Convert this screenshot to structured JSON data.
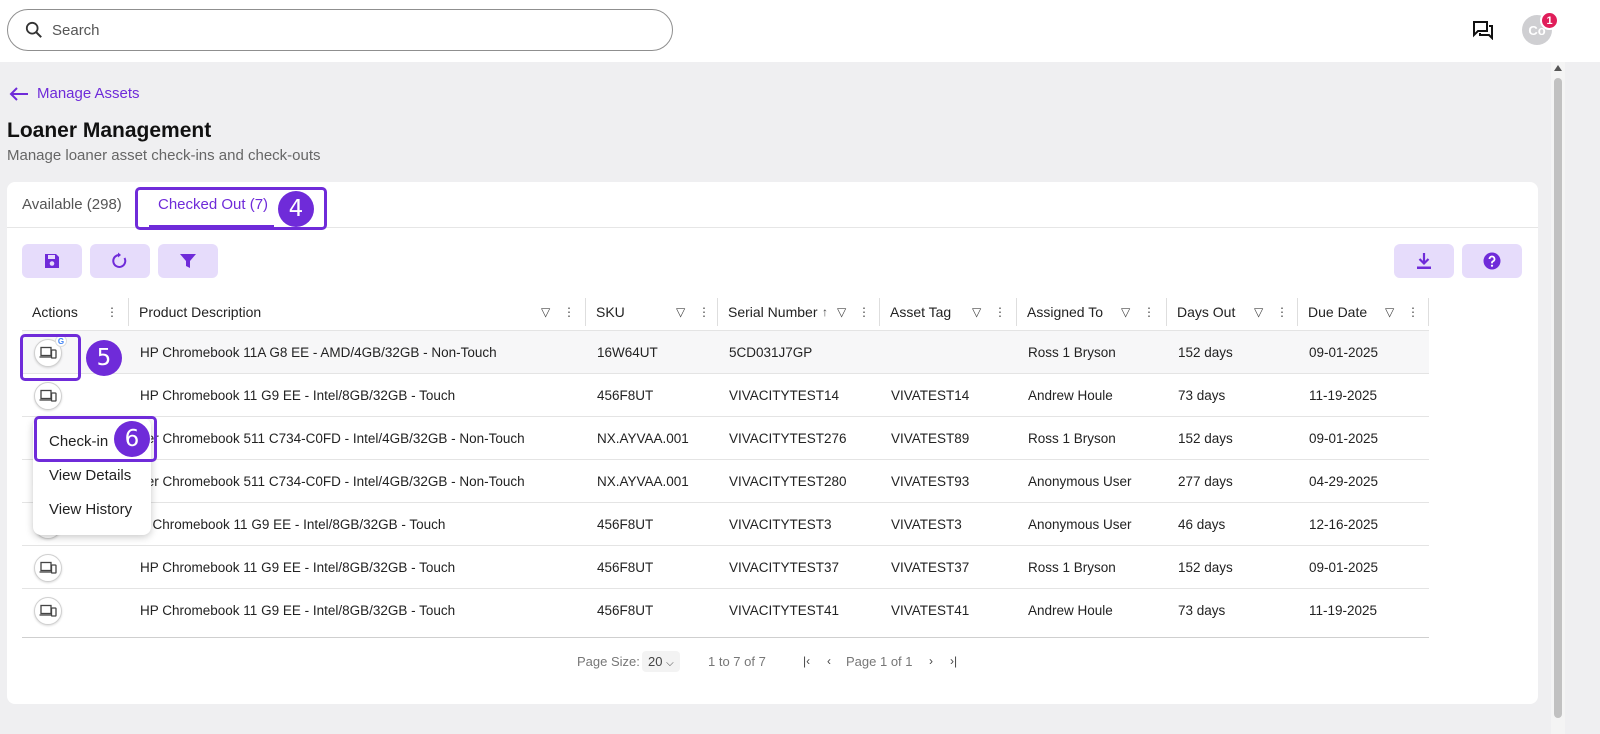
{
  "search": {
    "placeholder": "Search"
  },
  "header": {
    "avatar_initials": "Co",
    "notification_count": "1"
  },
  "breadcrumb": {
    "back_label": "Manage Assets"
  },
  "page": {
    "title": "Loaner Management",
    "subtitle": "Manage loaner asset check-ins and check-outs"
  },
  "tabs": [
    {
      "label": "Available (298)"
    },
    {
      "label": "Checked Out (7)"
    }
  ],
  "steps": {
    "tab": "4",
    "row_action": "5",
    "menu": "6"
  },
  "table": {
    "columns": [
      "Actions",
      "Product Description",
      "SKU",
      "Serial Number",
      "Asset Tag",
      "Assigned To",
      "Days Out",
      "Due Date"
    ],
    "sort_indicator": "↑",
    "rows": [
      {
        "product": "HP Chromebook 11A G8 EE - AMD/4GB/32GB - Non-Touch",
        "sku": "16W64UT",
        "serial": "5CD031J7GP",
        "asset_tag": "",
        "assigned_to": "Ross 1 Bryson",
        "days_out": "152 days",
        "due_date": "09-01-2025"
      },
      {
        "product": "HP Chromebook 11 G9 EE - Intel/8GB/32GB - Touch",
        "sku": "456F8UT",
        "serial": "VIVACITYTEST14",
        "asset_tag": "VIVATEST14",
        "assigned_to": "Andrew Houle",
        "days_out": "73 days",
        "due_date": "11-19-2025"
      },
      {
        "product": "cer Chromebook 511 C734-C0FD - Intel/4GB/32GB - Non-Touch",
        "sku": "NX.AYVAA.001",
        "serial": "VIVACITYTEST276",
        "asset_tag": "VIVATEST89",
        "assigned_to": "Ross 1 Bryson",
        "days_out": "152 days",
        "due_date": "09-01-2025"
      },
      {
        "product": "cer Chromebook 511 C734-C0FD - Intel/4GB/32GB - Non-Touch",
        "sku": "NX.AYVAA.001",
        "serial": "VIVACITYTEST280",
        "asset_tag": "VIVATEST93",
        "assigned_to": "Anonymous User",
        "days_out": "277 days",
        "due_date": "04-29-2025"
      },
      {
        "product": "P Chromebook 11 G9 EE - Intel/8GB/32GB - Touch",
        "sku": "456F8UT",
        "serial": "VIVACITYTEST3",
        "asset_tag": "VIVATEST3",
        "assigned_to": "Anonymous User",
        "days_out": "46 days",
        "due_date": "12-16-2025"
      },
      {
        "product": "HP Chromebook 11 G9 EE - Intel/8GB/32GB - Touch",
        "sku": "456F8UT",
        "serial": "VIVACITYTEST37",
        "asset_tag": "VIVATEST37",
        "assigned_to": "Ross 1 Bryson",
        "days_out": "152 days",
        "due_date": "09-01-2025"
      },
      {
        "product": "HP Chromebook 11 G9 EE - Intel/8GB/32GB - Touch",
        "sku": "456F8UT",
        "serial": "VIVACITYTEST41",
        "asset_tag": "VIVATEST41",
        "assigned_to": "Andrew Houle",
        "days_out": "73 days",
        "due_date": "11-19-2025"
      }
    ]
  },
  "context_menu": {
    "items": [
      "Check-in",
      "View Details",
      "View History"
    ]
  },
  "pagination": {
    "page_size_label": "Page Size:",
    "page_size_value": "20",
    "range": "1 to 7 of 7",
    "page_label": "Page 1 of 1"
  },
  "colors": {
    "accent": "#6f2bd9",
    "button_bg": "#e6dcfb",
    "badge": "#e01e5a"
  },
  "icons": [
    "search-icon",
    "chat-icon",
    "back-arrow-icon",
    "save-icon",
    "refresh-icon",
    "filter-icon",
    "download-icon",
    "help-icon",
    "device-icon",
    "google-badge-icon",
    "column-menu-icon",
    "column-filter-icon"
  ]
}
